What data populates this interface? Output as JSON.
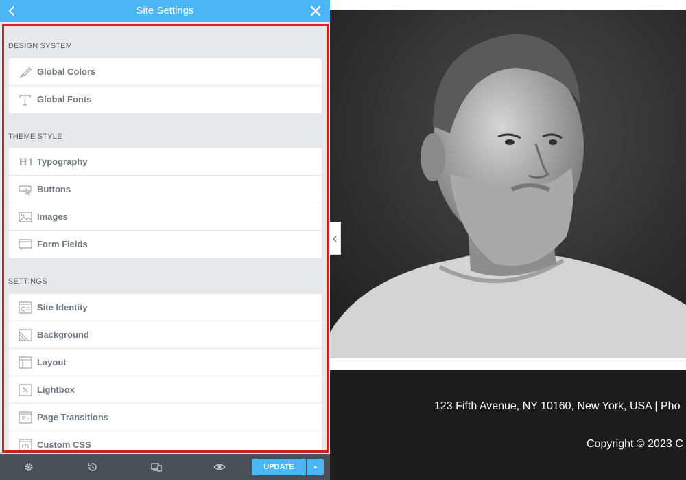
{
  "header": {
    "title": "Site Settings",
    "back_icon": "chevron-left-icon",
    "close_icon": "close-icon"
  },
  "sections": [
    {
      "title": "DESIGN SYSTEM",
      "items": [
        {
          "label": "Global Colors",
          "icon": "brush-icon"
        },
        {
          "label": "Global Fonts",
          "icon": "font-icon"
        }
      ]
    },
    {
      "title": "THEME STYLE",
      "items": [
        {
          "label": "Typography",
          "icon": "heading-icon"
        },
        {
          "label": "Buttons",
          "icon": "button-icon"
        },
        {
          "label": "Images",
          "icon": "image-icon"
        },
        {
          "label": "Form Fields",
          "icon": "form-field-icon"
        }
      ]
    },
    {
      "title": "SETTINGS",
      "items": [
        {
          "label": "Site Identity",
          "icon": "site-identity-icon"
        },
        {
          "label": "Background",
          "icon": "background-icon"
        },
        {
          "label": "Layout",
          "icon": "layout-icon"
        },
        {
          "label": "Lightbox",
          "icon": "lightbox-icon"
        },
        {
          "label": "Page Transitions",
          "icon": "page-transitions-icon"
        },
        {
          "label": "Custom CSS",
          "icon": "code-icon"
        }
      ]
    }
  ],
  "footer": {
    "update_label": "UPDATE",
    "icons": [
      "gear-icon",
      "history-icon",
      "responsive-icon",
      "eye-icon"
    ]
  },
  "preview": {
    "address": "123 Fifth Avenue, NY 10160, New York, USA | Pho",
    "copyright": "Copyright © 2023 C"
  },
  "colors": {
    "accent": "#4ab7f4",
    "highlight_border": "#d41e1e",
    "panel_bg": "#e6e9ec",
    "footer_bg": "#495157"
  }
}
